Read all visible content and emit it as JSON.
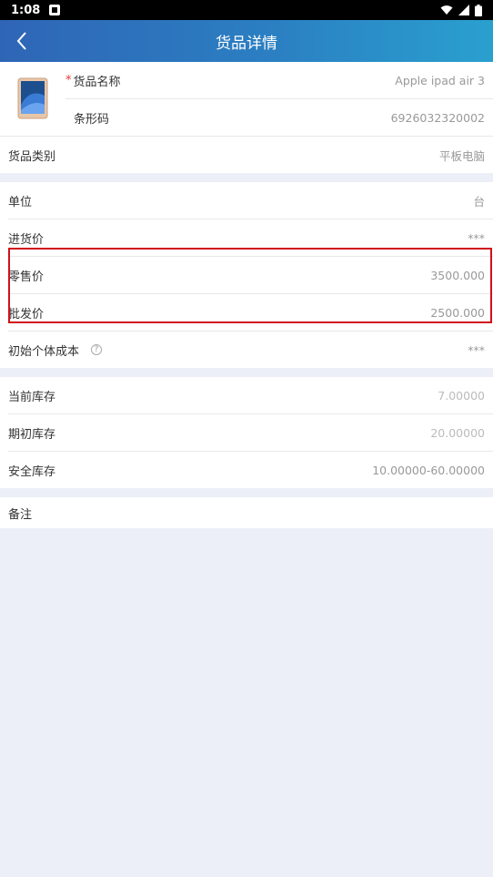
{
  "status_bar": {
    "time": "1:08"
  },
  "header": {
    "title": "货品详情"
  },
  "product": {
    "image_alt": "Apple ipad air 3",
    "name_label": "货品名称",
    "name_value": "Apple ipad air 3",
    "barcode_label": "条形码",
    "barcode_value": "6926032320002",
    "category_label": "货品类别",
    "category_value": "平板电脑"
  },
  "pricing": {
    "unit_label": "单位",
    "unit_value": "台",
    "purchase_label": "进货价",
    "purchase_value": "***",
    "retail_label": "零售价",
    "retail_value": "3500.000",
    "wholesale_label": "批发价",
    "wholesale_value": "2500.000",
    "initial_cost_label": "初始个体成本",
    "initial_cost_value": "***"
  },
  "stock": {
    "current_label": "当前库存",
    "current_value": "7.00000",
    "initial_label": "期初库存",
    "initial_value": "20.00000",
    "safety_label": "安全库存",
    "safety_value": "10.00000-60.00000"
  },
  "notes": {
    "label": "备注"
  },
  "colors": {
    "highlight": "#d0111b",
    "header_start": "#2f65b6",
    "header_end": "#2aa0cf"
  }
}
